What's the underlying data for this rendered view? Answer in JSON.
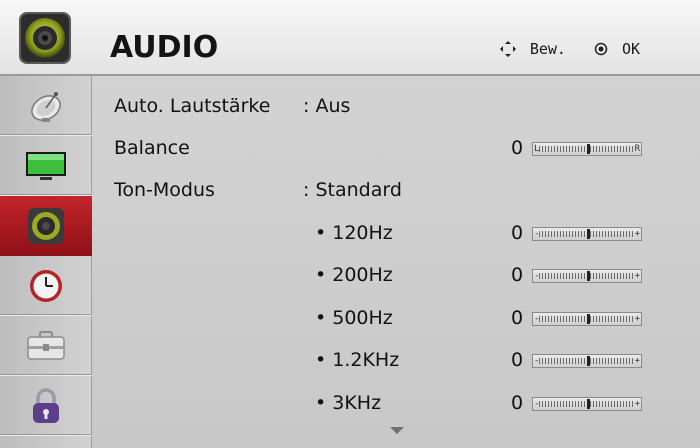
{
  "header": {
    "title": "AUDIO",
    "hints": [
      {
        "icon": "dpad-icon",
        "label": "Bew."
      },
      {
        "icon": "ok-icon",
        "label": "OK"
      }
    ]
  },
  "sidebar": {
    "items": [
      {
        "icon": "satellite-dish-icon",
        "active": false
      },
      {
        "icon": "tv-screen-icon",
        "active": false
      },
      {
        "icon": "speaker-icon",
        "active": true
      },
      {
        "icon": "clock-icon",
        "active": false
      },
      {
        "icon": "toolbox-icon",
        "active": false
      },
      {
        "icon": "padlock-icon",
        "active": false
      }
    ]
  },
  "settings": {
    "auto_volume": {
      "label": "Auto. Lautstärke",
      "value": ": Aus"
    },
    "balance": {
      "label": "Balance",
      "value": "0",
      "left_cap": "L",
      "right_cap": "R",
      "level": 0.5
    },
    "sound_mode": {
      "label": "Ton-Modus",
      "value": ": Standard"
    },
    "eq": [
      {
        "label": "• 120Hz",
        "value": "0",
        "left_cap": "-",
        "right_cap": "+",
        "level": 0.5
      },
      {
        "label": "• 200Hz",
        "value": "0",
        "left_cap": "-",
        "right_cap": "+",
        "level": 0.5
      },
      {
        "label": "• 500Hz",
        "value": "0",
        "left_cap": "-",
        "right_cap": "+",
        "level": 0.5
      },
      {
        "label": "• 1.2KHz",
        "value": "0",
        "left_cap": "-",
        "right_cap": "+",
        "level": 0.5
      },
      {
        "label": "• 3KHz",
        "value": "0",
        "left_cap": "-",
        "right_cap": "+",
        "level": 0.5
      }
    ]
  },
  "colors": {
    "active_item": "#b21d24",
    "text": "#121212"
  }
}
